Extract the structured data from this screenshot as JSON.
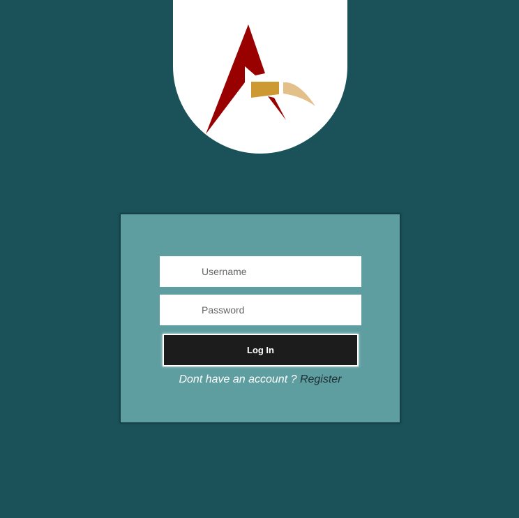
{
  "logo": {
    "icon": "stylized-letter-a-logo-icon",
    "colors": {
      "red": "#990000",
      "gold": "#cc9933",
      "light_gold": "#e3c08a"
    }
  },
  "login": {
    "username_placeholder": "Username",
    "password_placeholder": "Password",
    "login_label": "Log In",
    "no_account_prompt": "Dont have an account ?",
    "register_label": "Register"
  },
  "colors": {
    "background": "#1b525a",
    "card": "#5f9ea0",
    "button": "#1c1c1c"
  }
}
